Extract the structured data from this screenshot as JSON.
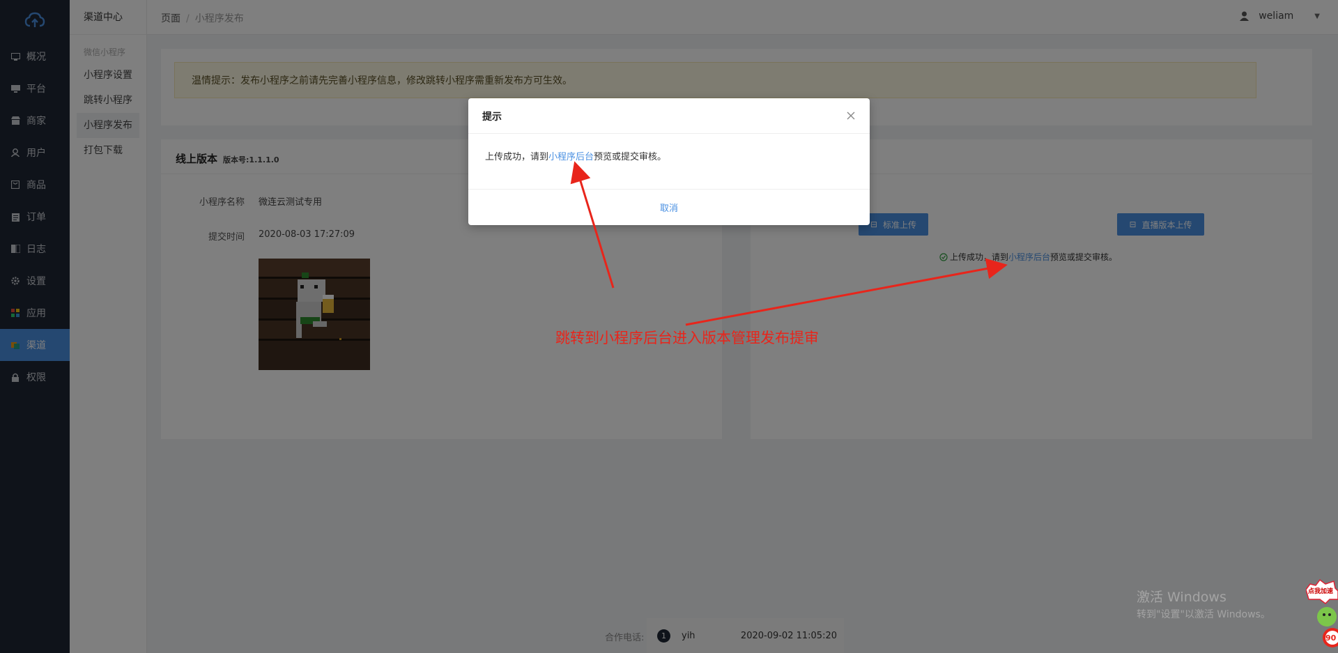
{
  "sidebar": {
    "items": [
      {
        "label": "概况",
        "icon": "dashboard-icon"
      },
      {
        "label": "平台",
        "icon": "monitor-icon"
      },
      {
        "label": "商家",
        "icon": "store-icon"
      },
      {
        "label": "用户",
        "icon": "user-icon"
      },
      {
        "label": "商品",
        "icon": "goods-icon"
      },
      {
        "label": "订单",
        "icon": "order-icon"
      },
      {
        "label": "日志",
        "icon": "log-icon"
      },
      {
        "label": "设置",
        "icon": "gear-icon"
      },
      {
        "label": "应用",
        "icon": "apps-icon"
      },
      {
        "label": "渠道",
        "icon": "channel-icon"
      },
      {
        "label": "权限",
        "icon": "lock-icon"
      }
    ],
    "active_index": 9
  },
  "submenu": {
    "title": "渠道中心",
    "group": "微信小程序",
    "items": [
      "小程序设置",
      "跳转小程序",
      "小程序发布",
      "打包下载"
    ],
    "active_index": 2
  },
  "header": {
    "breadcrumb_home": "页面",
    "breadcrumb_sep": "/",
    "breadcrumb_current": "小程序发布",
    "username": "weliam"
  },
  "notice": {
    "text": "温情提示：发布小程序之前请先完善小程序信息，修改跳转小程序需重新发布方可生效。"
  },
  "online": {
    "title": "线上版本",
    "version_label": "版本号:1.1.1.0",
    "name_label": "小程序名称",
    "name_value": "微连云测试专用",
    "time_label": "提交时间",
    "time_value": "2020-08-03 17:27:09"
  },
  "upload": {
    "standard_button": "标准上传",
    "live_button": "直播版本上传",
    "msg_prefix": "上传成功，请到",
    "msg_link": "小程序后台",
    "msg_suffix": "预览或提交审核。"
  },
  "footer": {
    "contact_label": "合作电话:",
    "chat_badge": "1",
    "chat_name": "yih",
    "chat_time": "2020-09-02 11:05:20"
  },
  "watermark": {
    "line1": "激活 Windows",
    "line2": "转到\"设置\"以激活 Windows。"
  },
  "modal": {
    "title": "提示",
    "msg_prefix": "上传成功，请到",
    "msg_link": "小程序后台",
    "msg_suffix": "预览或提交审核。",
    "cancel": "取消"
  },
  "annotation": {
    "text": "跳转到小程序后台进入版本管理发布提审",
    "color": "#e8251b"
  },
  "float_ad": {
    "label": "点我加速",
    "number": "90"
  },
  "colors": {
    "sidebar_bg": "#1f2735",
    "accent": "#4a90e2",
    "notice_bg": "#fcf8e3"
  }
}
